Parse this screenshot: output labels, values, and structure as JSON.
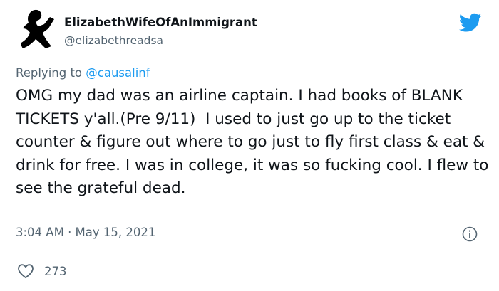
{
  "author": {
    "display_name": "ElizabethWifeOfAnImmigrant",
    "handle": "@elizabethreadsa",
    "avatar_icon": "woman-reading-silhouette-avatar"
  },
  "brand": {
    "logo_icon": "twitter-bird-icon",
    "color": "#1d9bf0"
  },
  "reply_context": {
    "prefix": "Replying to ",
    "mention": "@causalinf"
  },
  "tweet": {
    "text": "OMG my dad was an airline captain. I had books of BLANK TICKETS y'all.(Pre 9/11)  I used to just go up to the ticket counter & figure out where to go just to fly first class & eat & drink for free. I was in college, it was so fucking cool. I flew to see the grateful dead.",
    "timestamp": "3:04 AM · May 15, 2021"
  },
  "engagement": {
    "like_icon": "heart-icon",
    "like_count": "273"
  },
  "colors": {
    "text_primary": "#0f1419",
    "text_secondary": "#536471",
    "accent": "#1d9bf0",
    "divider": "#cfd9de"
  }
}
